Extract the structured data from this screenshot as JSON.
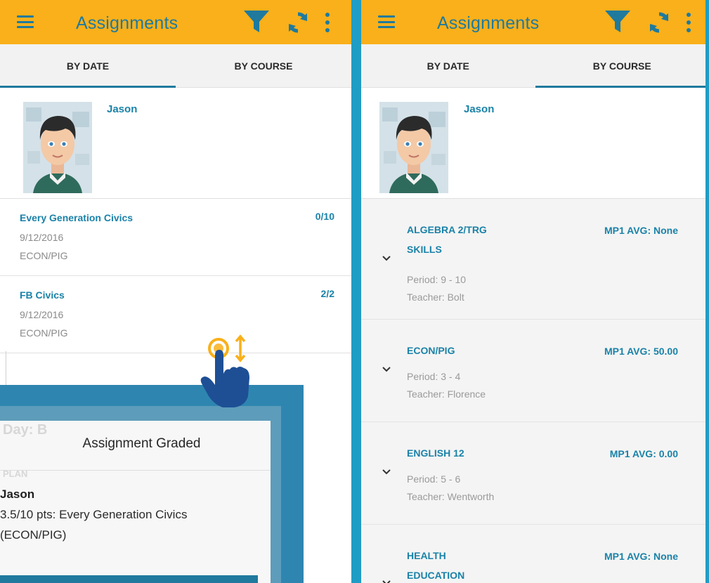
{
  "left": {
    "appbar": {
      "title": "Assignments",
      "menu_icon": "menu-icon",
      "filter_icon": "filter-icon",
      "refresh_icon": "refresh-icon",
      "overflow_icon": "more-vert-icon"
    },
    "tabs": [
      {
        "label": "BY DATE",
        "selected": true
      },
      {
        "label": "BY COURSE",
        "selected": false
      }
    ],
    "profile": {
      "name": "Jason"
    },
    "assignments": [
      {
        "title": "Every Generation Civics",
        "score": "0/10",
        "date": "9/12/2016",
        "course": "ECON/PIG"
      },
      {
        "title": "FB Civics",
        "score": "2/2",
        "date": "9/12/2016",
        "course": "ECON/PIG"
      }
    ]
  },
  "right": {
    "appbar": {
      "title": "Assignments",
      "menu_icon": "menu-icon",
      "filter_icon": "filter-icon",
      "refresh_icon": "refresh-icon",
      "overflow_icon": "more-vert-icon"
    },
    "tabs": [
      {
        "label": "BY DATE",
        "selected": false
      },
      {
        "label": "BY COURSE",
        "selected": true
      }
    ],
    "profile": {
      "name": "Jason"
    },
    "courses": [
      {
        "name_line1": "ALGEBRA 2/TRG",
        "name_line2": "SKILLS",
        "avg": "MP1 AVG: None",
        "period": "Period: 9 - 10",
        "teacher": "Teacher: Bolt"
      },
      {
        "name_line1": "ECON/PIG",
        "name_line2": "",
        "avg": "MP1 AVG: 50.00",
        "period": "Period: 3 - 4",
        "teacher": "Teacher: Florence"
      },
      {
        "name_line1": "ENGLISH 12",
        "name_line2": "",
        "avg": "MP1 AVG: 0.00",
        "period": "Period: 5 - 6",
        "teacher": "Teacher: Wentworth"
      },
      {
        "name_line1": "HEALTH",
        "name_line2": "EDUCATION",
        "avg": "MP1 AVG: None",
        "period": "",
        "teacher": ""
      }
    ]
  },
  "notification": {
    "title": "Assignment Graded",
    "student": "Jason",
    "line1": "3.5/10 pts: Every Generation Civics",
    "line2": "(ECON/PIG)",
    "background_text_1": "Day: B",
    "background_text_2": "PLAN"
  },
  "colors": {
    "appbar": "#f9b01a",
    "accent": "#1a82a8",
    "gutter": "#1f9dc4",
    "callout": "#2e86b0"
  }
}
